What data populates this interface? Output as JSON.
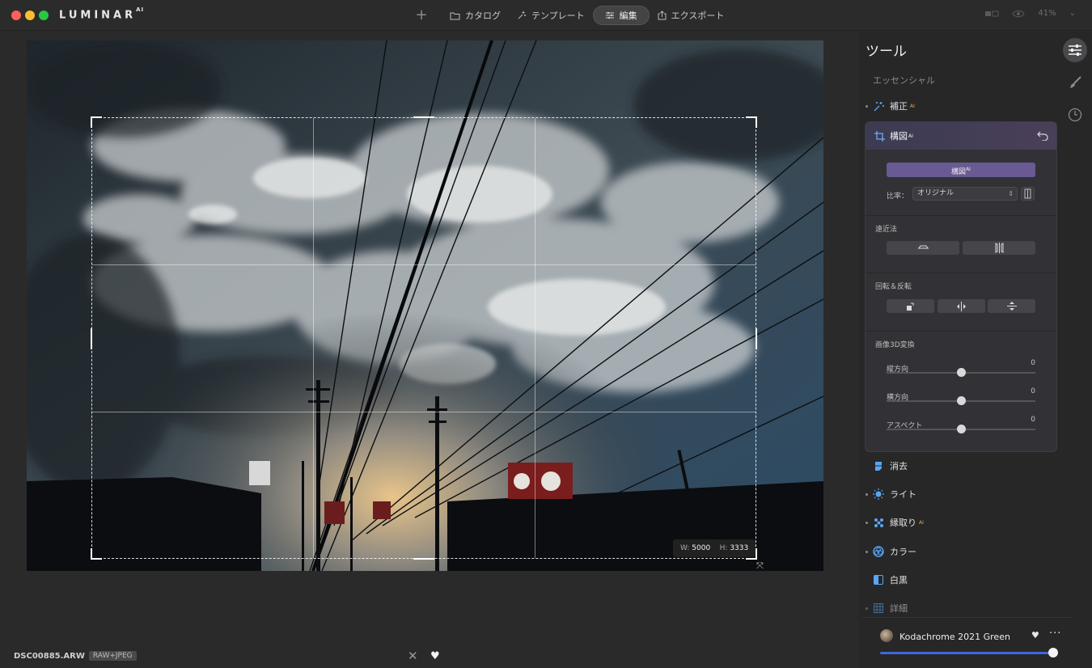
{
  "app": {
    "logo_text": "LUMINAR",
    "logo_sup": "AI"
  },
  "nav": {
    "add_label": "+",
    "items": [
      {
        "label": "カタログ",
        "icon": "folder-icon"
      },
      {
        "label": "テンプレート",
        "icon": "sparkle-icon"
      },
      {
        "label": "編集",
        "icon": "sliders-icon",
        "active": true
      },
      {
        "label": "エクスポート",
        "icon": "share-icon"
      }
    ],
    "zoom": "41%"
  },
  "canvas": {
    "size_w_label": "W:",
    "size_w": "5000",
    "size_h_label": "H:",
    "size_h": "3333",
    "filename": "DSC00885.ARW",
    "filetype": "RAW+JPEG"
  },
  "panel": {
    "title": "ツール",
    "section_essentials": "エッセンシャル",
    "tools_top": [
      {
        "label": "補正",
        "ai": "AI",
        "icon": "enhance-icon",
        "dot": true
      }
    ],
    "composition": {
      "title": "構図",
      "title_sup": "AI",
      "ai_button": "構図",
      "ai_button_sup": "AI",
      "ratio_label": "比率：",
      "ratio_value": "オリジナル",
      "perspective_label": "遠近法",
      "rotate_label": "回転＆反転",
      "transform_label": "画像3D変換",
      "sliders": [
        {
          "label": "縦方向",
          "value": "0",
          "pos": 0.5
        },
        {
          "label": "横方向",
          "value": "0",
          "pos": 0.5
        },
        {
          "label": "アスペクト",
          "value": "0",
          "pos": 0.5
        }
      ]
    },
    "tools_bottom": [
      {
        "label": "消去",
        "ai": "",
        "icon": "erase-icon",
        "dot": false
      },
      {
        "label": "ライト",
        "ai": "",
        "icon": "light-icon",
        "dot": true
      },
      {
        "label": "縁取り",
        "ai": "AI",
        "icon": "structure-icon",
        "dot": true
      },
      {
        "label": "カラー",
        "ai": "",
        "icon": "color-icon",
        "dot": true
      },
      {
        "label": "白黒",
        "ai": "",
        "icon": "bw-icon",
        "dot": false
      },
      {
        "label": "詳細",
        "ai": "",
        "icon": "details-icon",
        "dot": true
      }
    ]
  },
  "preset": {
    "name": "Kodachrome 2021 Green",
    "amount": 1.0
  },
  "colors": {
    "accent": "#6a5a93",
    "slider_blue": "#4068d8",
    "icon_blue": "#5aa5f5"
  }
}
